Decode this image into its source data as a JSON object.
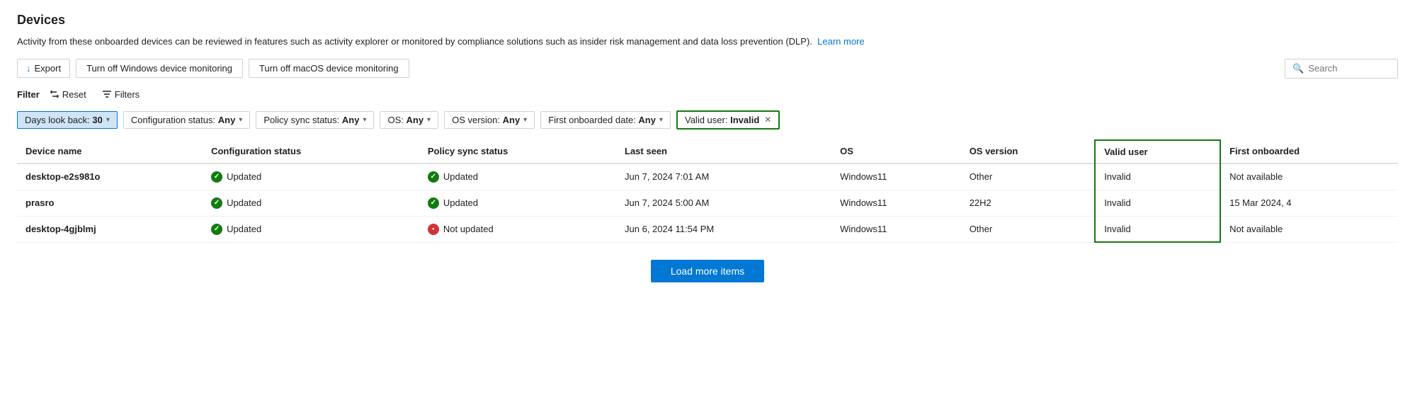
{
  "page": {
    "title": "Devices",
    "description": "Activity from these onboarded devices can be reviewed in features such as activity explorer or monitored by compliance solutions such as insider risk management and data loss prevention (DLP).",
    "learn_more_link": "Learn more"
  },
  "toolbar": {
    "export_label": "Export",
    "btn_windows": "Turn off Windows device monitoring",
    "btn_macos": "Turn off macOS device monitoring",
    "search_placeholder": "Search"
  },
  "filter_bar": {
    "filter_label": "Filter",
    "reset_label": "Reset",
    "filters_label": "Filters"
  },
  "chips": [
    {
      "id": "days-look-back",
      "label": "Days look back: ",
      "value": "30",
      "active": true
    },
    {
      "id": "config-status",
      "label": "Configuration status: ",
      "value": "Any",
      "active": false
    },
    {
      "id": "policy-sync",
      "label": "Policy sync status: ",
      "value": "Any",
      "active": false
    },
    {
      "id": "os",
      "label": "OS: ",
      "value": "Any",
      "active": false
    },
    {
      "id": "os-version",
      "label": "OS version: ",
      "value": "Any",
      "active": false
    },
    {
      "id": "first-onboarded",
      "label": "First onboarded date: ",
      "value": "Any",
      "active": false
    }
  ],
  "valid_user_chip": {
    "label": "Valid user: ",
    "value": "Invalid"
  },
  "table": {
    "columns": [
      {
        "id": "device-name",
        "label": "Device name"
      },
      {
        "id": "config-status",
        "label": "Configuration status"
      },
      {
        "id": "policy-sync",
        "label": "Policy sync status"
      },
      {
        "id": "last-seen",
        "label": "Last seen"
      },
      {
        "id": "os",
        "label": "OS"
      },
      {
        "id": "os-version",
        "label": "OS version"
      },
      {
        "id": "valid-user",
        "label": "Valid user"
      },
      {
        "id": "first-onboarded",
        "label": "First onboarded"
      }
    ],
    "rows": [
      {
        "device_name": "desktop-e2s981o",
        "config_status": "Updated",
        "config_icon": "green",
        "policy_sync": "Updated",
        "policy_icon": "green",
        "last_seen": "Jun 7, 2024 7:01 AM",
        "os": "Windows11",
        "os_version": "Other",
        "valid_user": "Invalid",
        "first_onboarded": "Not available"
      },
      {
        "device_name": "prasro",
        "config_status": "Updated",
        "config_icon": "green",
        "policy_sync": "Updated",
        "policy_icon": "green",
        "last_seen": "Jun 7, 2024 5:00 AM",
        "os": "Windows11",
        "os_version": "22H2",
        "valid_user": "Invalid",
        "first_onboarded": "15 Mar 2024, 4"
      },
      {
        "device_name": "desktop-4gjblmj",
        "config_status": "Updated",
        "config_icon": "green",
        "policy_sync": "Not updated",
        "policy_icon": "red",
        "last_seen": "Jun 6, 2024 11:54 PM",
        "os": "Windows11",
        "os_version": "Other",
        "valid_user": "Invalid",
        "first_onboarded": "Not available"
      }
    ]
  },
  "load_more": {
    "label": "Load more items"
  }
}
